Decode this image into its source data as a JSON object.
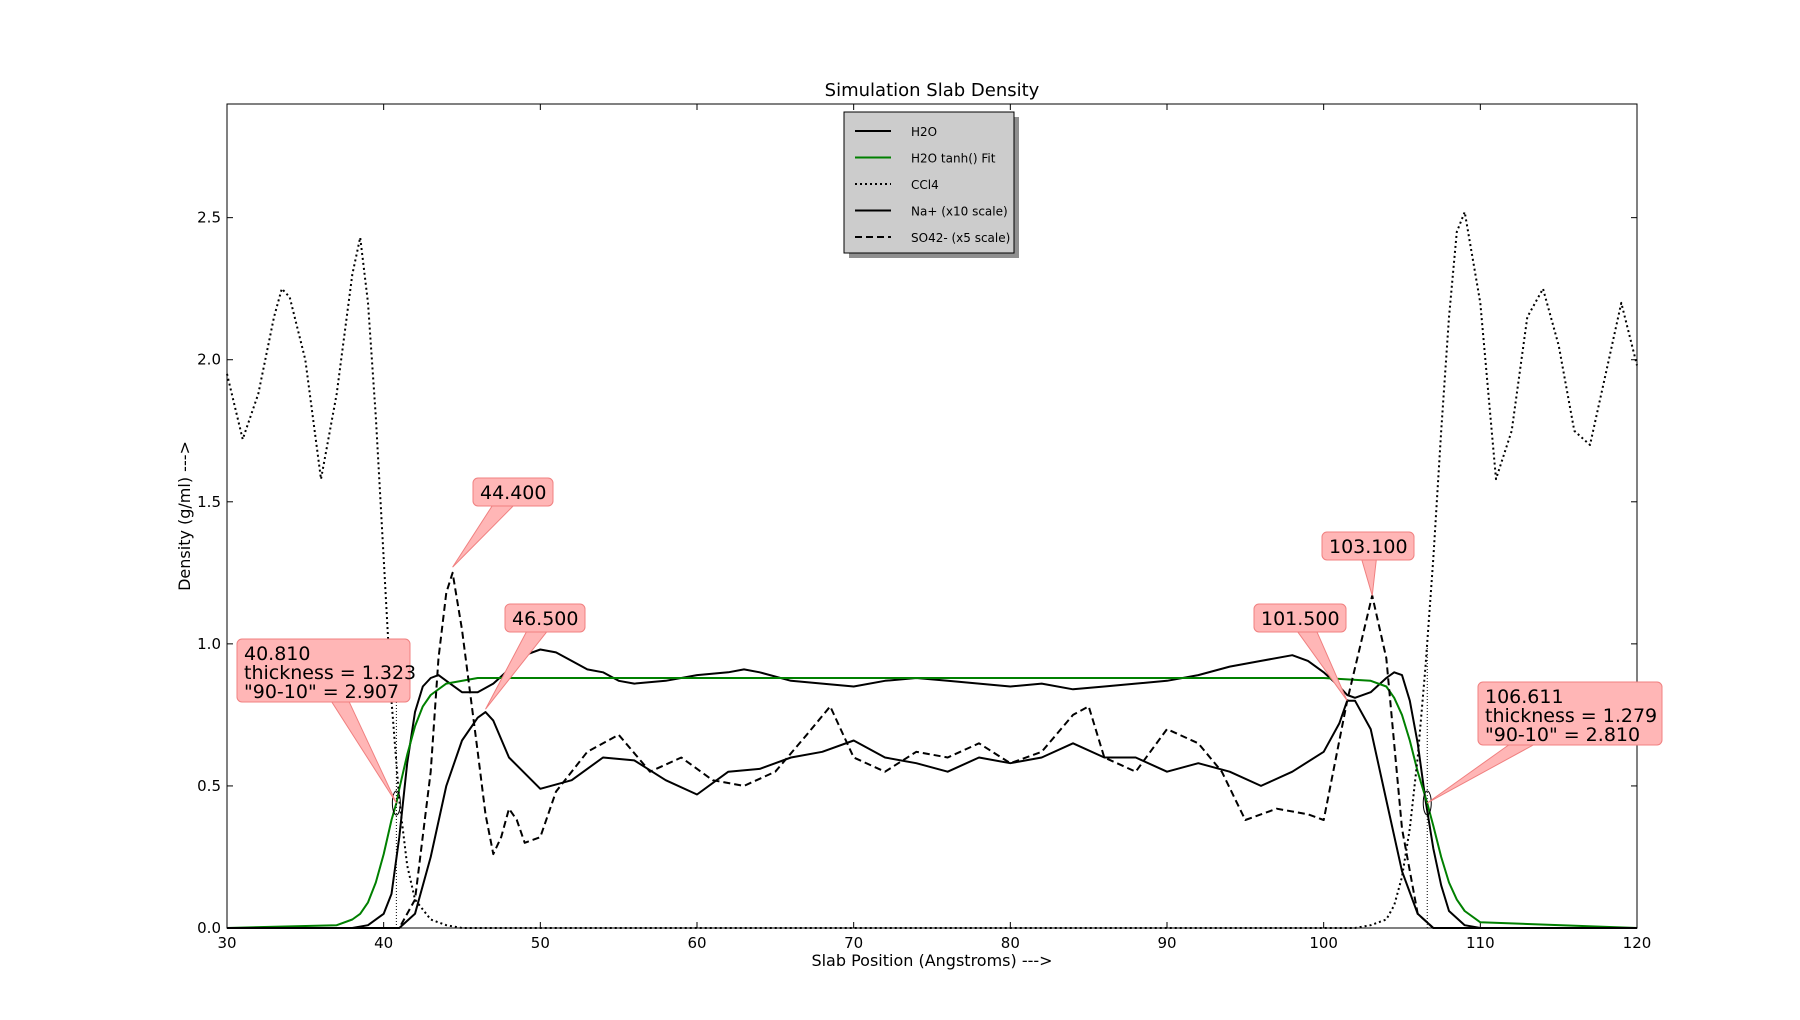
{
  "chart_data": {
    "type": "line",
    "title": "Simulation Slab Density",
    "xlabel": "Slab Position (Angstroms) --->",
    "ylabel": "Density (g/ml) --->",
    "xlim": [
      30,
      120
    ],
    "ylim": [
      0.0,
      2.9
    ],
    "xticks": [
      "30",
      "40",
      "50",
      "60",
      "70",
      "80",
      "90",
      "100",
      "110",
      "120"
    ],
    "yticks": [
      "0.0",
      "0.5",
      "1.0",
      "1.5",
      "2.0",
      "2.5"
    ],
    "legend_placement": "top-center",
    "legend": [
      "H2O",
      "H2O tanh() Fit",
      "CCl4",
      "Na+ (x10 scale)",
      "SO42- (x5 scale)"
    ],
    "series": [
      {
        "name": "H2O",
        "color": "#000000",
        "style": "solid",
        "x": [
          30,
          38,
          39,
          40,
          40.5,
          41,
          41.5,
          42,
          42.5,
          43,
          43.5,
          44,
          45,
          46,
          47,
          48,
          49,
          50,
          51,
          52,
          53,
          54,
          55,
          56,
          58,
          60,
          62,
          63,
          64,
          66,
          68,
          70,
          72,
          74,
          76,
          78,
          80,
          82,
          84,
          86,
          88,
          90,
          92,
          94,
          96,
          98,
          99,
          100,
          101,
          101.5,
          102,
          103,
          104,
          104.5,
          105,
          105.5,
          106,
          106.5,
          107,
          107.5,
          108,
          109,
          110,
          120
        ],
        "y": [
          0,
          0,
          0.01,
          0.05,
          0.12,
          0.32,
          0.58,
          0.76,
          0.85,
          0.88,
          0.89,
          0.87,
          0.83,
          0.83,
          0.86,
          0.91,
          0.96,
          0.98,
          0.97,
          0.94,
          0.91,
          0.9,
          0.87,
          0.86,
          0.87,
          0.89,
          0.9,
          0.91,
          0.9,
          0.87,
          0.86,
          0.85,
          0.87,
          0.88,
          0.87,
          0.86,
          0.85,
          0.86,
          0.84,
          0.85,
          0.86,
          0.87,
          0.89,
          0.92,
          0.94,
          0.96,
          0.94,
          0.9,
          0.85,
          0.82,
          0.81,
          0.83,
          0.88,
          0.9,
          0.89,
          0.8,
          0.65,
          0.45,
          0.28,
          0.15,
          0.06,
          0.01,
          0,
          0
        ]
      },
      {
        "name": "H2O tanh() Fit",
        "color": "#008000",
        "style": "solid",
        "x": [
          30,
          37,
          38,
          38.5,
          39,
          39.5,
          40,
          40.5,
          40.81,
          41,
          41.5,
          42,
          42.5,
          43,
          44,
          46,
          100,
          103,
          104,
          104.5,
          105,
          105.5,
          106,
          106.611,
          107,
          107.5,
          108,
          108.5,
          109,
          110,
          120
        ],
        "y": [
          0,
          0.01,
          0.03,
          0.05,
          0.09,
          0.16,
          0.26,
          0.38,
          0.44,
          0.49,
          0.61,
          0.71,
          0.78,
          0.82,
          0.86,
          0.88,
          0.88,
          0.87,
          0.85,
          0.81,
          0.75,
          0.66,
          0.55,
          0.44,
          0.36,
          0.25,
          0.16,
          0.1,
          0.06,
          0.02,
          0
        ]
      },
      {
        "name": "CCl4",
        "color": "#000000",
        "style": "dotted",
        "x": [
          30,
          31,
          32,
          33,
          33.5,
          34,
          35,
          36,
          37,
          38,
          38.5,
          39,
          39.5,
          40,
          40.5,
          41,
          41.5,
          42,
          43,
          44,
          45,
          100,
          102,
          103,
          104,
          104.5,
          105,
          105.5,
          106,
          106.5,
          107,
          107.5,
          108,
          108.5,
          109,
          110,
          111,
          112,
          113,
          114,
          115,
          116,
          117,
          118,
          119,
          120
        ],
        "y": [
          1.95,
          1.72,
          1.88,
          2.15,
          2.25,
          2.22,
          2.0,
          1.58,
          1.88,
          2.3,
          2.43,
          2.2,
          1.8,
          1.3,
          0.8,
          0.45,
          0.22,
          0.1,
          0.03,
          0.01,
          0,
          0,
          0,
          0.01,
          0.03,
          0.08,
          0.18,
          0.35,
          0.6,
          0.92,
          1.3,
          1.75,
          2.15,
          2.45,
          2.52,
          2.2,
          1.58,
          1.75,
          2.15,
          2.25,
          2.05,
          1.75,
          1.7,
          1.95,
          2.2,
          1.98
        ]
      },
      {
        "name": "Na+ (x10 scale)",
        "color": "#000000",
        "style": "solid",
        "x": [
          30,
          41,
          42,
          43,
          44,
          45,
          46,
          46.5,
          47,
          48,
          50,
          52,
          54,
          56,
          58,
          60,
          62,
          64,
          66,
          68,
          70,
          72,
          74,
          76,
          78,
          80,
          82,
          84,
          86,
          88,
          90,
          92,
          94,
          96,
          98,
          100,
          101,
          101.5,
          102,
          103,
          104,
          105,
          106,
          107,
          120
        ],
        "y": [
          0,
          0,
          0.05,
          0.25,
          0.5,
          0.66,
          0.74,
          0.76,
          0.73,
          0.6,
          0.49,
          0.52,
          0.6,
          0.59,
          0.52,
          0.47,
          0.55,
          0.56,
          0.6,
          0.62,
          0.66,
          0.6,
          0.58,
          0.55,
          0.6,
          0.58,
          0.6,
          0.65,
          0.6,
          0.6,
          0.55,
          0.58,
          0.55,
          0.5,
          0.55,
          0.62,
          0.72,
          0.8,
          0.8,
          0.7,
          0.45,
          0.2,
          0.05,
          0,
          0
        ]
      },
      {
        "name": "SO42- (x5 scale)",
        "color": "#000000",
        "style": "dashed",
        "x": [
          30,
          41,
          42,
          43,
          43.5,
          44,
          44.4,
          45,
          46,
          46.5,
          47,
          47.5,
          48,
          48.5,
          49,
          50,
          51,
          53,
          55,
          57,
          59,
          61,
          63,
          65,
          67,
          68.5,
          70,
          72,
          74,
          76,
          78,
          80,
          82,
          84,
          85,
          86,
          88,
          90,
          92,
          93.5,
          95,
          97,
          99,
          100,
          101.5,
          103.1,
          104,
          105,
          106,
          107,
          120
        ],
        "y": [
          0,
          0,
          0.1,
          0.55,
          0.95,
          1.18,
          1.25,
          1.05,
          0.62,
          0.4,
          0.26,
          0.32,
          0.42,
          0.38,
          0.3,
          0.32,
          0.48,
          0.62,
          0.68,
          0.55,
          0.6,
          0.52,
          0.5,
          0.55,
          0.68,
          0.78,
          0.6,
          0.55,
          0.62,
          0.6,
          0.65,
          0.58,
          0.62,
          0.75,
          0.78,
          0.6,
          0.55,
          0.7,
          0.65,
          0.55,
          0.38,
          0.42,
          0.4,
          0.38,
          0.8,
          1.17,
          0.95,
          0.35,
          0.05,
          0,
          0
        ]
      }
    ],
    "callouts": [
      {
        "lines": [
          "44.400"
        ],
        "x": 44.4,
        "y": 1.27
      },
      {
        "lines": [
          "46.500"
        ],
        "x": 46.5,
        "y": 0.77
      },
      {
        "lines": [
          "40.810",
          "thickness = 1.323",
          "\"90-10\" = 2.907"
        ],
        "x": 40.81,
        "y": 0.44
      },
      {
        "lines": [
          "103.100"
        ],
        "x": 103.1,
        "y": 1.17
      },
      {
        "lines": [
          "101.500"
        ],
        "x": 101.5,
        "y": 0.8
      },
      {
        "lines": [
          "106.611",
          "thickness = 1.279",
          "\"90-10\" = 2.810"
        ],
        "x": 106.611,
        "y": 0.44
      }
    ]
  }
}
